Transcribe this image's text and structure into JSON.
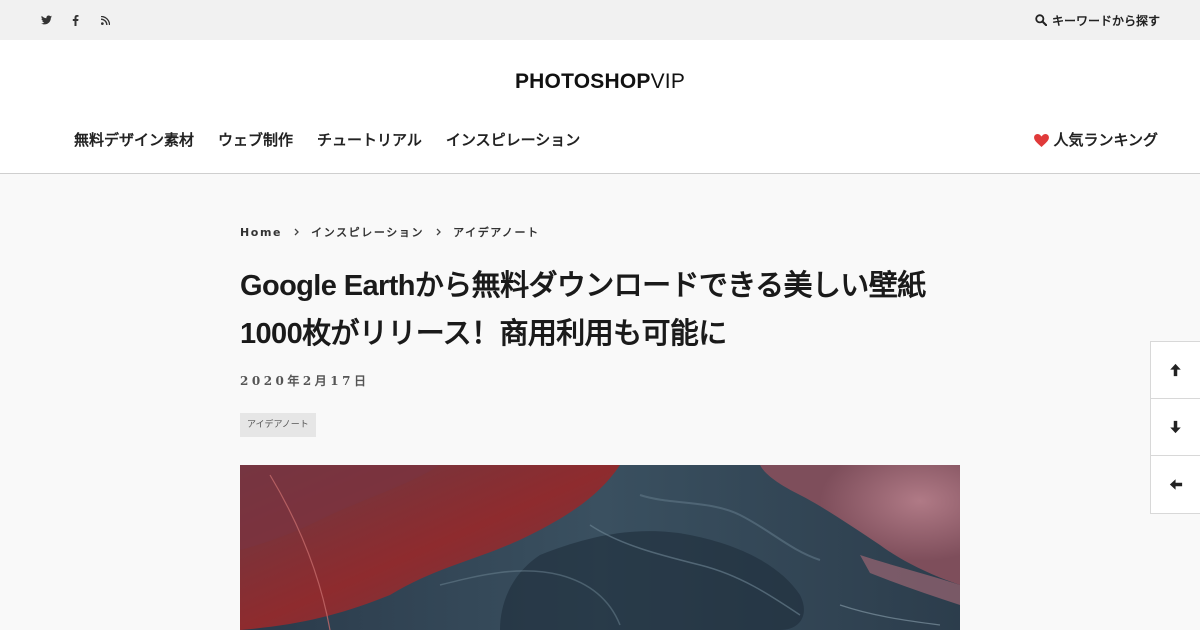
{
  "topbar": {
    "social": [
      {
        "name": "twitter-icon"
      },
      {
        "name": "facebook-icon"
      },
      {
        "name": "rss-icon"
      }
    ],
    "search_label": "キーワードから探す"
  },
  "header": {
    "logo_bold": "PHOTOSHOP",
    "logo_light": "VIP",
    "nav": [
      "無料デザイン素材",
      "ウェブ制作",
      "チュートリアル",
      "インスピレーション"
    ],
    "ranking_label": "人気ランキング"
  },
  "article": {
    "breadcrumb": [
      "Home",
      "インスピレーション",
      "アイデアノート"
    ],
    "title_line1": "Google Earthから無料ダウンロードできる美しい壁紙",
    "title_line2": "1000枚がリリース！商用利用も可能に",
    "date": "2020年2月17日",
    "tag": "アイデアノート"
  },
  "colors": {
    "accent_heart": "#e03a3a",
    "topbar_bg": "#f1f1f1",
    "page_bg": "#f9f9f9"
  },
  "side_buttons": [
    "arrow-up-icon",
    "arrow-down-icon",
    "arrow-left-icon"
  ]
}
